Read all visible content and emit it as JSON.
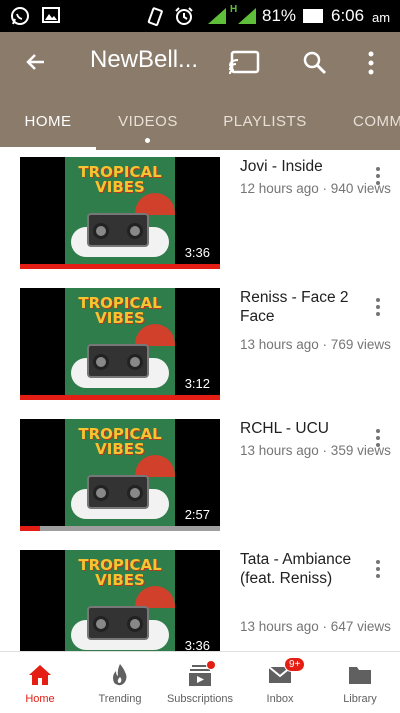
{
  "status_bar": {
    "battery": "81%",
    "time": "6:06",
    "ampm": "am",
    "network": "H"
  },
  "app_bar": {
    "title": "NewBell...",
    "back_icon": "arrow-left-icon",
    "cast_icon": "cast-icon",
    "search_icon": "search-icon",
    "more_icon": "more-vertical-icon",
    "color": "#8a7b6b"
  },
  "tabs": [
    {
      "label": "HOME",
      "active": true
    },
    {
      "label": "VIDEOS",
      "active": false
    },
    {
      "label": "PLAYLISTS",
      "active": false
    },
    {
      "label": "COMM",
      "active": false
    }
  ],
  "videos": [
    {
      "title": "Jovi - Inside",
      "meta": "12 hours ago · 940 views",
      "duration": "3:36",
      "thumb_text": "TROPICAL VIBES",
      "watched": 1.0
    },
    {
      "title": "Reniss - Face 2 Face",
      "meta": "13 hours ago · 769 views",
      "duration": "3:12",
      "thumb_text": "TROPICAL VIBES",
      "watched": 1.0
    },
    {
      "title": "RCHL - UCU",
      "meta": "13 hours ago · 359 views",
      "duration": "2:57",
      "thumb_text": "TROPICAL VIBES",
      "watched": 0.1
    },
    {
      "title": "Tata - Ambiance (feat. Reniss)",
      "meta": "13 hours ago · 647 views",
      "duration": "3:36",
      "thumb_text": "TROPICAL VIBES",
      "watched": 0
    }
  ],
  "bottom_nav": [
    {
      "label": "Home",
      "icon": "home-icon",
      "active": true
    },
    {
      "label": "Trending",
      "icon": "flame-icon",
      "active": false
    },
    {
      "label": "Subscriptions",
      "icon": "subscriptions-icon",
      "active": false
    },
    {
      "label": "Inbox",
      "icon": "mail-icon",
      "active": false,
      "badge": "9+"
    },
    {
      "label": "Library",
      "icon": "folder-icon",
      "active": false
    }
  ],
  "colors": {
    "accent": "#e41e14",
    "appbar": "#8a7b6b"
  }
}
